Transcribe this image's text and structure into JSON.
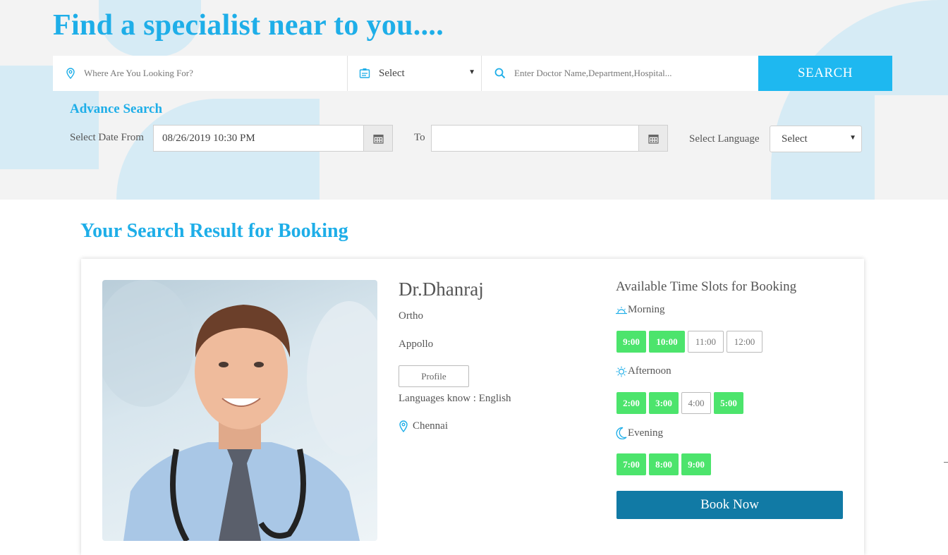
{
  "hero": {
    "title": "Find a specialist near to you....",
    "search": {
      "location_placeholder": "Where Are You Looking For?",
      "category_value": "Select",
      "doctor_placeholder": "Enter Doctor Name,Department,Hospital...",
      "button_label": "SEARCH"
    },
    "advance": {
      "title": "Advance Search",
      "date_from_label": "Select Date From",
      "date_from_value": "08/26/2019 10:30 PM",
      "to_label": "To",
      "date_to_value": "",
      "language_label": "Select Language",
      "language_value": "Select"
    }
  },
  "results": {
    "title": "Your Search Result for Booking",
    "doctor": {
      "name": "Dr.Dhanraj",
      "specialty": "Ortho",
      "hospital": "Appollo",
      "profile_button": "Profile",
      "languages": "Languages know : English",
      "location": "Chennai"
    },
    "slots": {
      "title": "Available Time Slots for Booking",
      "morning_label": "Morning",
      "afternoon_label": "Afternoon",
      "evening_label": "Evening",
      "morning": [
        {
          "time": "9:00",
          "available": true
        },
        {
          "time": "10:00",
          "available": true
        },
        {
          "time": "11:00",
          "available": false
        },
        {
          "time": "12:00",
          "available": false
        }
      ],
      "afternoon": [
        {
          "time": "2:00",
          "available": true
        },
        {
          "time": "3:00",
          "available": true
        },
        {
          "time": "4:00",
          "available": false
        },
        {
          "time": "5:00",
          "available": true
        }
      ],
      "evening": [
        {
          "time": "7:00",
          "available": true
        },
        {
          "time": "8:00",
          "available": true
        },
        {
          "time": "9:00",
          "available": true
        }
      ]
    },
    "book_button": "Book Now"
  },
  "colors": {
    "accent": "#1eaee8",
    "search_button": "#1eb8f0",
    "slot_available": "#4ce46c",
    "book_button": "#117aa5"
  },
  "icons": {
    "location": "map-pin-icon",
    "category": "id-card-icon",
    "search": "magnifier-icon",
    "calendar": "calendar-icon",
    "morning": "sunrise-icon",
    "afternoon": "sun-icon",
    "evening": "moon-icon"
  }
}
